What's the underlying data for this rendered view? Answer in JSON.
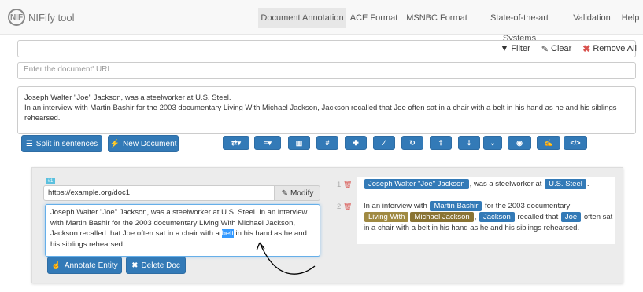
{
  "brand": {
    "logo": "NIF",
    "name": "NIFify tool"
  },
  "nav": [
    "Document Annotation",
    "ACE Format",
    "MSNBC Format",
    "State-of-the-art Systems",
    "Validation",
    "Help"
  ],
  "toolbar": {
    "filter": "Filter",
    "clear": "Clear",
    "remove_all": "Remove All"
  },
  "uri_placeholder": "Enter the document' URI",
  "main_text": {
    "line1": "Joseph Walter \"Joe\" Jackson, was a steelworker at U.S. Steel.",
    "line2": "In an interview with Martin Bashir for the 2003 documentary Living With Michael Jackson, Jackson recalled that Joe often sat in a chair with a belt in his hand as he and his siblings",
    "line3": "rehearsed."
  },
  "buttons": {
    "split": "Split in sentences",
    "new_doc": "New Document",
    "annotate": "Annotate Entity",
    "delete_doc": "Delete Doc",
    "modify": "Modify"
  },
  "icon_toolbar": [
    "shuffle-icon",
    "align-icon",
    "chart-icon",
    "hash-icon",
    "puzzle-icon",
    "wand-icon",
    "refresh-icon",
    "upload-icon",
    "download-icon",
    "chevron-down-icon",
    "eye-icon",
    "edit-icon",
    "code-icon"
  ],
  "doc": {
    "badge": "#1",
    "url": "https://example.org/doc1",
    "text_before": "Joseph Walter \"Joe\" Jackson, was a steelworker at U.S. Steel. In an interview with Martin Bashir for the 2003 documentary Living With Michael Jackson, Jackson recalled that Joe often sat in a chair with a ",
    "selected": "belt",
    "text_after": " in his hand as he and his siblings rehearsed."
  },
  "sentences": [
    {
      "num": "1",
      "parts": [
        {
          "ent": "Joseph Walter \"Joe\" Jackson",
          "cls": "ent-blue"
        },
        {
          "t": ", was a steelworker at "
        },
        {
          "ent": "U.S. Steel",
          "cls": "ent-blue"
        },
        {
          "t": "."
        }
      ]
    },
    {
      "num": "2",
      "parts": [
        {
          "t": "In an interview with "
        },
        {
          "ent": "Martin Bashir",
          "cls": "ent-blue"
        },
        {
          "t": " for the 2003 documentary "
        },
        {
          "ent": "Living With",
          "cls": "ent-olive2"
        },
        {
          "ent": "Michael Jackson",
          "cls": "ent-olive"
        },
        {
          "t": ", "
        },
        {
          "ent": "Jackson",
          "cls": "ent-blue"
        },
        {
          "t": " recalled that "
        },
        {
          "ent": "Joe",
          "cls": "ent-blue"
        },
        {
          "t": " often sat in a chair with a belt in his hand as he and his siblings rehearsed."
        }
      ]
    }
  ]
}
